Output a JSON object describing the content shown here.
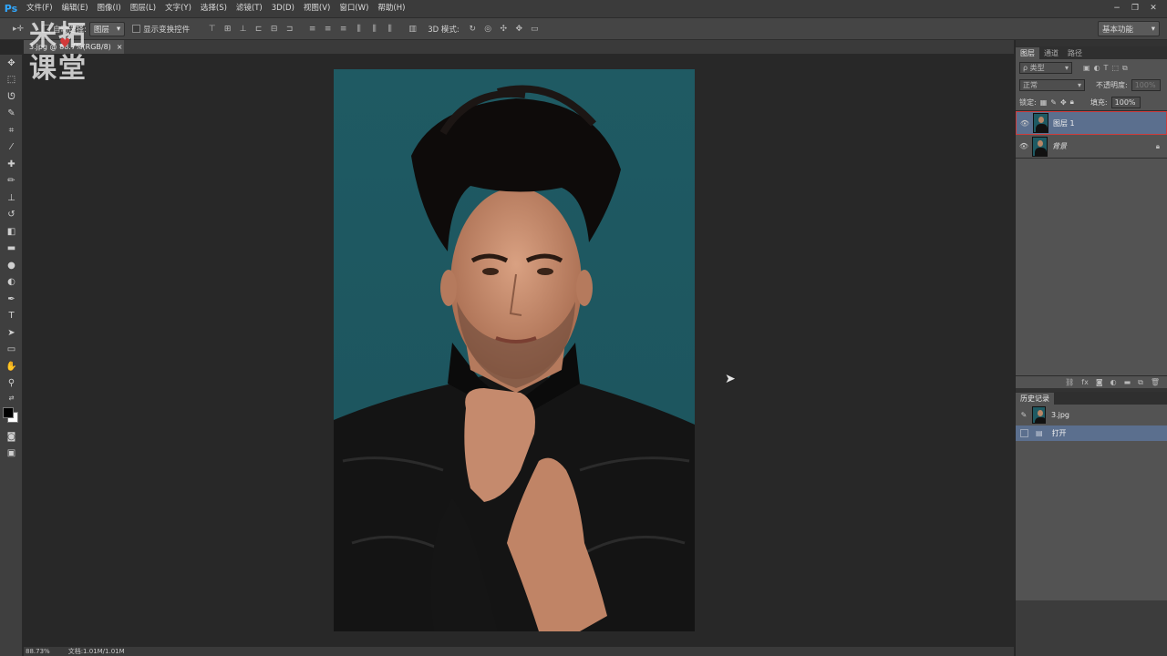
{
  "menubar": {
    "logo": "Ps",
    "items": [
      "文件(F)",
      "编辑(E)",
      "图像(I)",
      "图层(L)",
      "文字(Y)",
      "选择(S)",
      "滤镜(T)",
      "3D(D)",
      "视图(V)",
      "窗口(W)",
      "帮助(H)"
    ],
    "window_controls": [
      "−",
      "❐",
      "✕"
    ]
  },
  "options": {
    "auto_select_label": "自动选择:",
    "auto_select_value": "图层",
    "show_transform_label": "显示变换控件",
    "mode_3d_label": "3D 模式:",
    "workspace": "基本功能"
  },
  "document": {
    "tab_title": "3.jpg @ 88.7%(RGB/8)",
    "tab_close": "×",
    "zoom_status": "88.73%",
    "doc_status": "文档:1.01M/1.01M"
  },
  "watermark": {
    "line1": "米拓",
    "line2": "课堂"
  },
  "layers_panel": {
    "tabs": [
      "图层",
      "通道",
      "路径"
    ],
    "filter_type": "ρ 类型",
    "blend_mode": "正常",
    "opacity_label": "不透明度:",
    "opacity_value": "100%",
    "lock_label": "锁定:",
    "fill_label": "填充:",
    "fill_value": "100%",
    "layers": [
      {
        "name": "图层 1",
        "selected": true
      },
      {
        "name": "背景",
        "selected": false,
        "locked": true
      }
    ],
    "footer_icons": [
      "link-icon",
      "fx-icon",
      "mask-icon",
      "adjustment-icon",
      "folder-icon",
      "new-layer-icon",
      "trash-icon"
    ]
  },
  "history_panel": {
    "title": "历史记录",
    "snapshot": "3.jpg",
    "entries": [
      "打开"
    ]
  },
  "colors": {
    "accent": "#31a8ff",
    "selection": "#5b6f8e",
    "layer_highlight_border": "#cc3b3b",
    "photo_bg": "#1f5a63"
  }
}
